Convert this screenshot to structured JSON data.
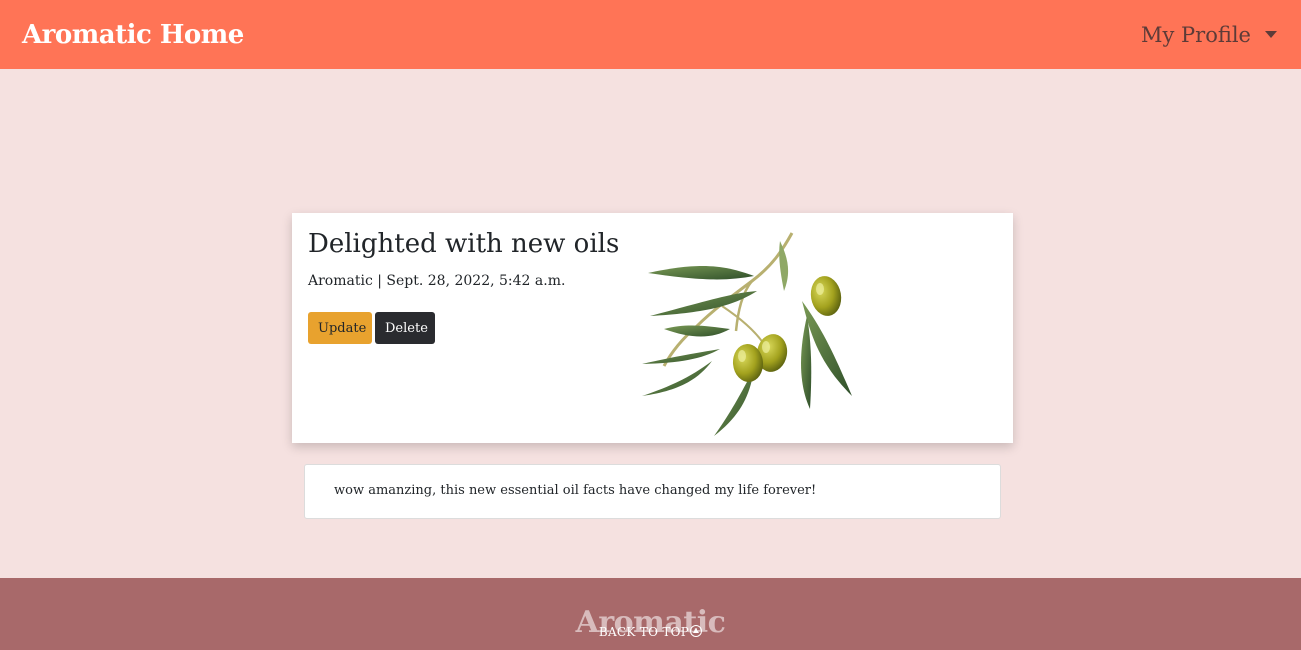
{
  "navbar": {
    "brand": "Aromatic Home",
    "profile_label": "My Profile"
  },
  "post": {
    "title": "Delighted with new oils",
    "meta": "Aromatic | Sept. 28, 2022, 5:42 a.m.",
    "update_label": "Update",
    "delete_label": "Delete",
    "image_icon": "olive-branch-icon"
  },
  "comments": [
    {
      "text": "wow amanzing, this new essential oil facts have changed my life forever!"
    }
  ],
  "footer": {
    "brand": "Aromatic",
    "back_to_top": "BACK TO TOP"
  },
  "colors": {
    "navbar": "#ff7456",
    "page_background": "#f5e1e0",
    "update_button": "#e8a22e",
    "delete_button": "#2a2b2f",
    "footer": "#a8696a"
  }
}
